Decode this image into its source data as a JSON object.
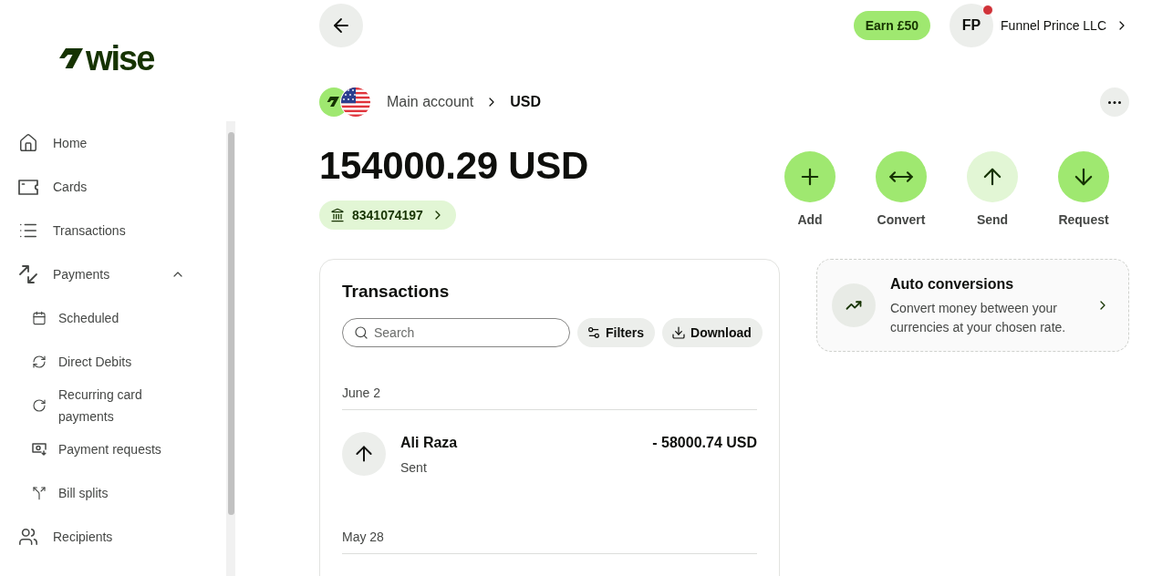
{
  "sidebar": {
    "logo": "wise",
    "items": [
      {
        "label": "Home",
        "selected": false
      },
      {
        "label": "Cards",
        "selected": false
      },
      {
        "label": "Transactions",
        "selected": false
      },
      {
        "label": "Payments",
        "selected": false,
        "expanded": true,
        "children": [
          {
            "label": "Scheduled",
            "selected": false
          },
          {
            "label": "Direct Debits",
            "selected": false
          },
          {
            "label": "Recurring card payments",
            "selected": false
          },
          {
            "label": "Payment requests",
            "selected": false
          },
          {
            "label": "Bill splits",
            "selected": false
          }
        ]
      },
      {
        "label": "Recipients",
        "selected": false
      }
    ]
  },
  "header": {
    "earn_button": "Earn £50",
    "avatar": {
      "initials": "FP",
      "notification": true
    },
    "account_name": "Funnel Prince LLC"
  },
  "breadcrumb": {
    "parent": "Main account",
    "current": "USD"
  },
  "balance": {
    "amount": "154000.29 USD",
    "account_number": "8341074197"
  },
  "actions": [
    {
      "label": "Add",
      "disabled": false
    },
    {
      "label": "Convert",
      "disabled": false
    },
    {
      "label": "Send",
      "disabled": true
    },
    {
      "label": "Request",
      "disabled": false
    }
  ],
  "transactions": {
    "title": "Transactions",
    "search": {
      "placeholder": "Search"
    },
    "buttons": [
      "Filters",
      "Download"
    ],
    "groups": [
      {
        "date": "June 2",
        "items": [
          {
            "name": "Ali Raza",
            "status": "Sent",
            "amount": "- 58000.74 USD"
          }
        ]
      },
      {
        "date": "May 28"
      }
    ]
  },
  "promo": {
    "title": "Auto conversions",
    "description": "Convert money between your currencies at your chosen rate."
  }
}
